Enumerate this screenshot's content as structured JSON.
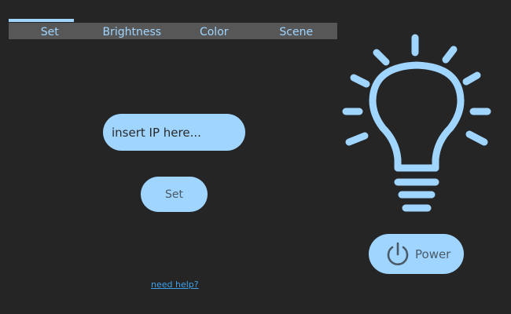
{
  "tabs": [
    {
      "label": "Set",
      "active": true
    },
    {
      "label": "Brightness",
      "active": false
    },
    {
      "label": "Color",
      "active": false
    },
    {
      "label": "Scene",
      "active": false
    }
  ],
  "ip_input": {
    "placeholder": "insert IP here...",
    "value": ""
  },
  "set_button": {
    "label": "Set"
  },
  "help_link": {
    "label": "need help?"
  },
  "bulb": {
    "icon": "lightbulb-icon"
  },
  "power_button": {
    "label": "Power",
    "icon": "power-icon"
  },
  "colors": {
    "background": "#252525",
    "accent": "#9fd5ff",
    "tabbar": "#575757",
    "link": "#3fa1ea"
  }
}
